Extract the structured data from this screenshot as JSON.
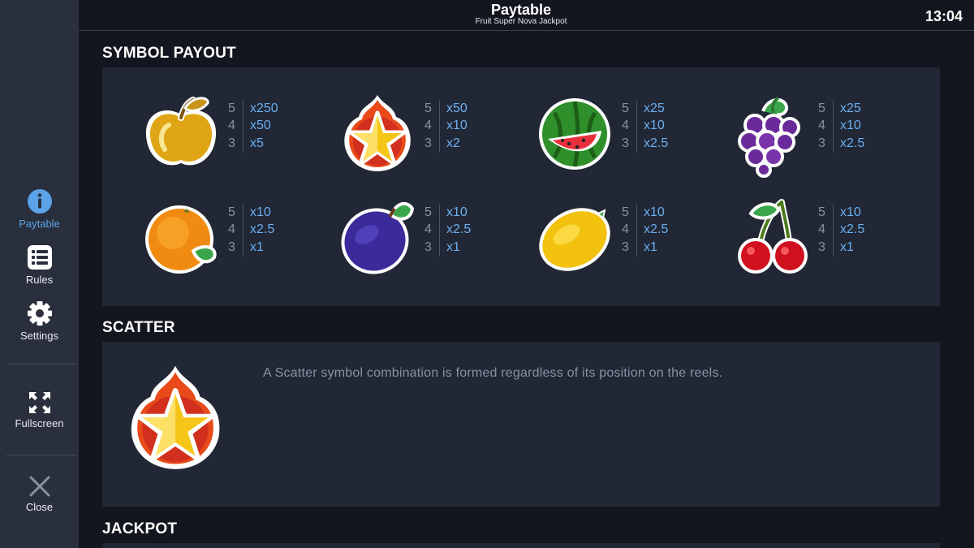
{
  "header": {
    "title": "Paytable",
    "subtitle": "Fruit Super Nova Jackpot",
    "clock": "13:04"
  },
  "sidebar": {
    "items": [
      {
        "label": "Paytable",
        "icon": "info-icon",
        "active": true
      },
      {
        "label": "Rules",
        "icon": "list-icon"
      },
      {
        "label": "Settings",
        "icon": "gear-icon"
      },
      {
        "label": "Fullscreen",
        "icon": "fullscreen-icon"
      },
      {
        "label": "Close",
        "icon": "close-icon"
      }
    ]
  },
  "sections": {
    "symbol_payout": "SYMBOL PAYOUT",
    "scatter": "SCATTER",
    "jackpot": "JACKPOT"
  },
  "symbols": [
    {
      "name": "golden-apple",
      "pays": [
        {
          "count": "5",
          "mult": "x250"
        },
        {
          "count": "4",
          "mult": "x50"
        },
        {
          "count": "3",
          "mult": "x5"
        }
      ]
    },
    {
      "name": "star",
      "pays": [
        {
          "count": "5",
          "mult": "x50"
        },
        {
          "count": "4",
          "mult": "x10"
        },
        {
          "count": "3",
          "mult": "x2"
        }
      ]
    },
    {
      "name": "watermelon",
      "pays": [
        {
          "count": "5",
          "mult": "x25"
        },
        {
          "count": "4",
          "mult": "x10"
        },
        {
          "count": "3",
          "mult": "x2.5"
        }
      ]
    },
    {
      "name": "grapes",
      "pays": [
        {
          "count": "5",
          "mult": "x25"
        },
        {
          "count": "4",
          "mult": "x10"
        },
        {
          "count": "3",
          "mult": "x2.5"
        }
      ]
    },
    {
      "name": "orange",
      "pays": [
        {
          "count": "5",
          "mult": "x10"
        },
        {
          "count": "4",
          "mult": "x2.5"
        },
        {
          "count": "3",
          "mult": "x1"
        }
      ]
    },
    {
      "name": "plum",
      "pays": [
        {
          "count": "5",
          "mult": "x10"
        },
        {
          "count": "4",
          "mult": "x2.5"
        },
        {
          "count": "3",
          "mult": "x1"
        }
      ]
    },
    {
      "name": "lemon",
      "pays": [
        {
          "count": "5",
          "mult": "x10"
        },
        {
          "count": "4",
          "mult": "x2.5"
        },
        {
          "count": "3",
          "mult": "x1"
        }
      ]
    },
    {
      "name": "cherries",
      "pays": [
        {
          "count": "5",
          "mult": "x10"
        },
        {
          "count": "4",
          "mult": "x2.5"
        },
        {
          "count": "3",
          "mult": "x1"
        }
      ]
    }
  ],
  "scatter": {
    "description": "A Scatter symbol combination is formed regardless of its position on the reels."
  },
  "colors": {
    "accent": "#5ba3e8",
    "sidebar": "#2a2f3d",
    "panel": "#222735",
    "background": "#13161e"
  }
}
